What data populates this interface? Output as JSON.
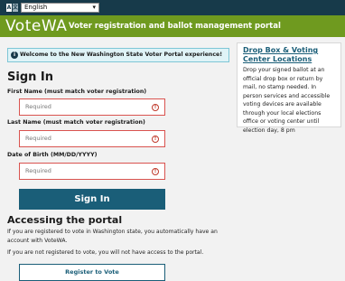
{
  "topbar": {
    "lang_icon_a": "A",
    "lang_icon_b": "文",
    "language_selected": "English"
  },
  "brand": {
    "logo_text": "VoteWA",
    "title": "Voter registration and ballot management portal"
  },
  "banner": {
    "text": "Welcome to the New Washington State Voter Portal experience!"
  },
  "signin": {
    "heading": "Sign In",
    "first_name_label": "First Name (must match voter registration)",
    "first_name_placeholder": "Required",
    "last_name_label": "Last Name (must match voter registration)",
    "last_name_placeholder": "Required",
    "dob_label": "Date of Birth (MM/DD/YYYY)",
    "dob_placeholder": "Required",
    "button": "Sign In"
  },
  "portal": {
    "heading": "Accessing the portal",
    "para1": "If you are registered to vote in Washington state, you automatically have an account with VoteWA.",
    "para2": "If you are not registered to vote, you will not have access to the portal.",
    "register_button": "Register to Vote"
  },
  "sidebar": {
    "title": "Drop Box & Voting Center Locations",
    "text": "Drop your signed ballot at an official drop box or return by mail, no stamp needed. In person services and accessible voting devices are available through your local elections office or voting center until election day, 8 pm"
  }
}
